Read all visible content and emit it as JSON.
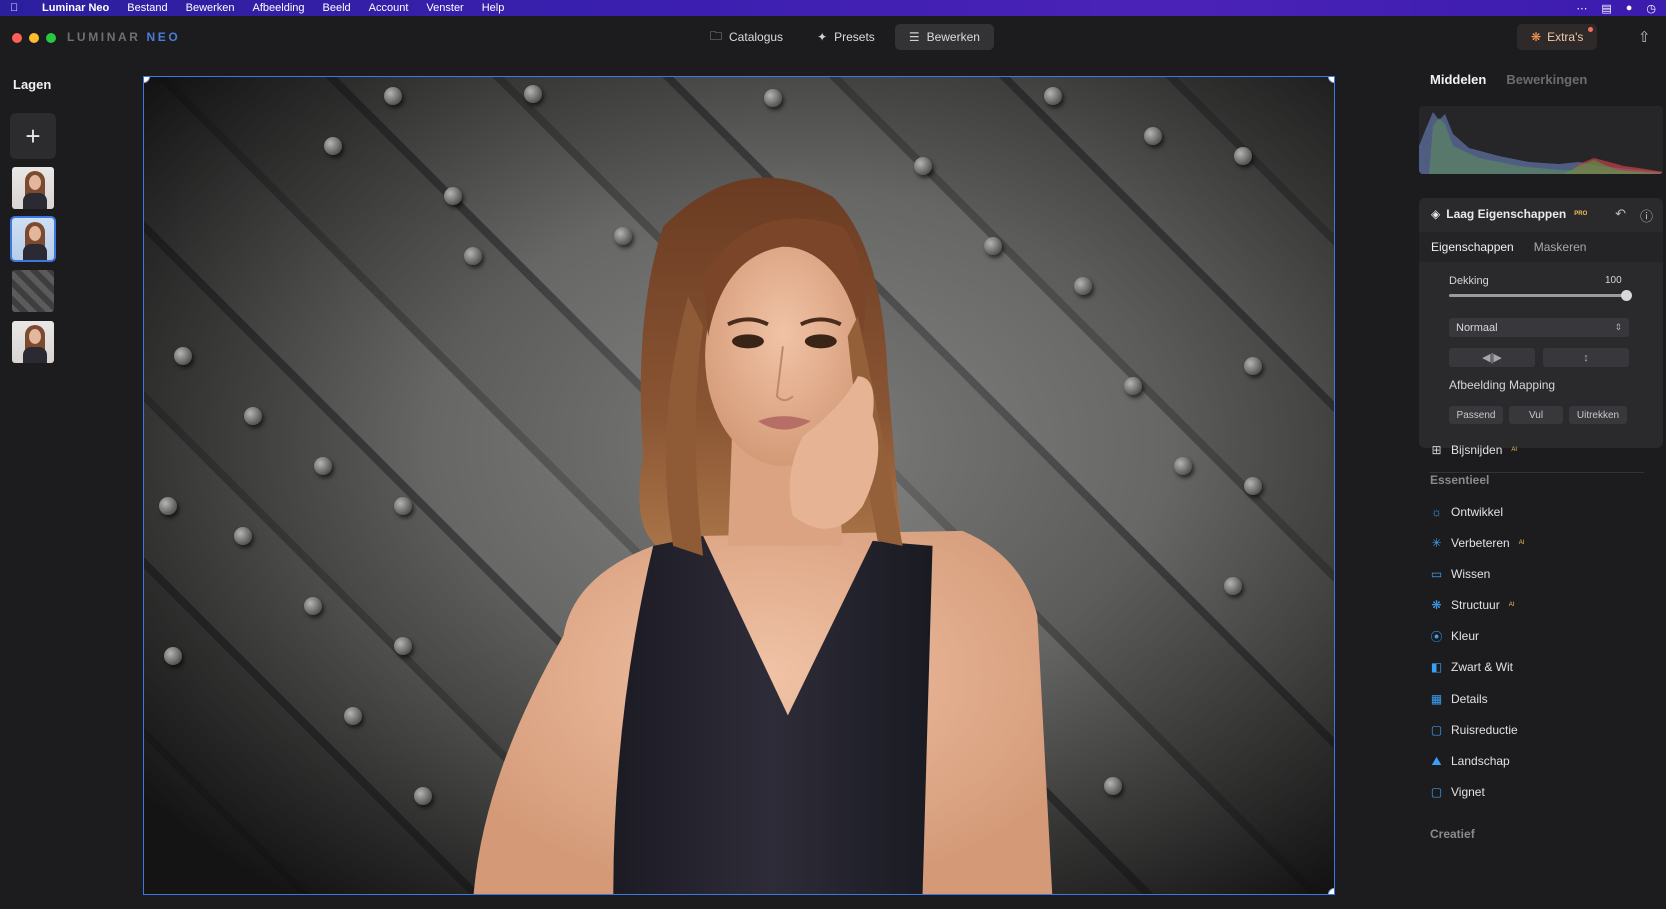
{
  "menubar": {
    "app": "Luminar Neo",
    "items": [
      "Bestand",
      "Bewerken",
      "Afbeelding",
      "Beeld",
      "Account",
      "Venster",
      "Help"
    ]
  },
  "toolbar": {
    "logo_main": "LUMINAR ",
    "logo_accent": "NEO",
    "tabs": [
      {
        "label": "Catalogus",
        "icon": "folder-icon"
      },
      {
        "label": "Presets",
        "icon": "sparkle-icon"
      },
      {
        "label": "Bewerken",
        "icon": "sliders-icon"
      }
    ],
    "active_tab": "Bewerken",
    "extras_label": "Extra's"
  },
  "layers": {
    "title": "Lagen",
    "items": [
      {
        "type": "portrait"
      },
      {
        "type": "portrait",
        "selected": true
      },
      {
        "type": "metal-texture"
      },
      {
        "type": "portrait"
      }
    ]
  },
  "right_panel": {
    "tabs": [
      "Middelen",
      "Bewerkingen"
    ],
    "active_tab": "Middelen",
    "layer_props": {
      "title": "Laag Eigenschappen",
      "badge": "PRO",
      "subtabs": [
        "Eigenschappen",
        "Maskeren"
      ],
      "opacity_label": "Dekking",
      "opacity_value": "100",
      "blend_mode": "Normaal",
      "mapping_label": "Afbeelding Mapping",
      "mapping_buttons": [
        "Passend",
        "Vul",
        "Uitrekken"
      ]
    },
    "crop": {
      "label": "Bijsnijden",
      "ai": "AI"
    },
    "section_essential": "Essentieel",
    "tools": [
      {
        "label": "Ontwikkel",
        "ai": "",
        "icon": "sun-icon"
      },
      {
        "label": "Verbeteren",
        "ai": "AI",
        "icon": "sparkle-icon"
      },
      {
        "label": "Wissen",
        "ai": "",
        "icon": "eraser-icon"
      },
      {
        "label": "Structuur",
        "ai": "AI",
        "icon": "structure-icon"
      },
      {
        "label": "Kleur",
        "ai": "",
        "icon": "color-icon"
      },
      {
        "label": "Zwart & Wit",
        "ai": "",
        "icon": "bw-icon"
      },
      {
        "label": "Details",
        "ai": "",
        "icon": "details-icon"
      },
      {
        "label": "Ruisreductie",
        "ai": "",
        "icon": "noise-icon"
      },
      {
        "label": "Landschap",
        "ai": "",
        "icon": "landscape-icon"
      },
      {
        "label": "Vignet",
        "ai": "",
        "icon": "vignette-icon"
      }
    ],
    "section_creative": "Creatief"
  },
  "colors": {
    "accent_blue": "#3b78e6",
    "tool_icon": "#3aa0f5",
    "ai_badge": "#f0c15a"
  }
}
